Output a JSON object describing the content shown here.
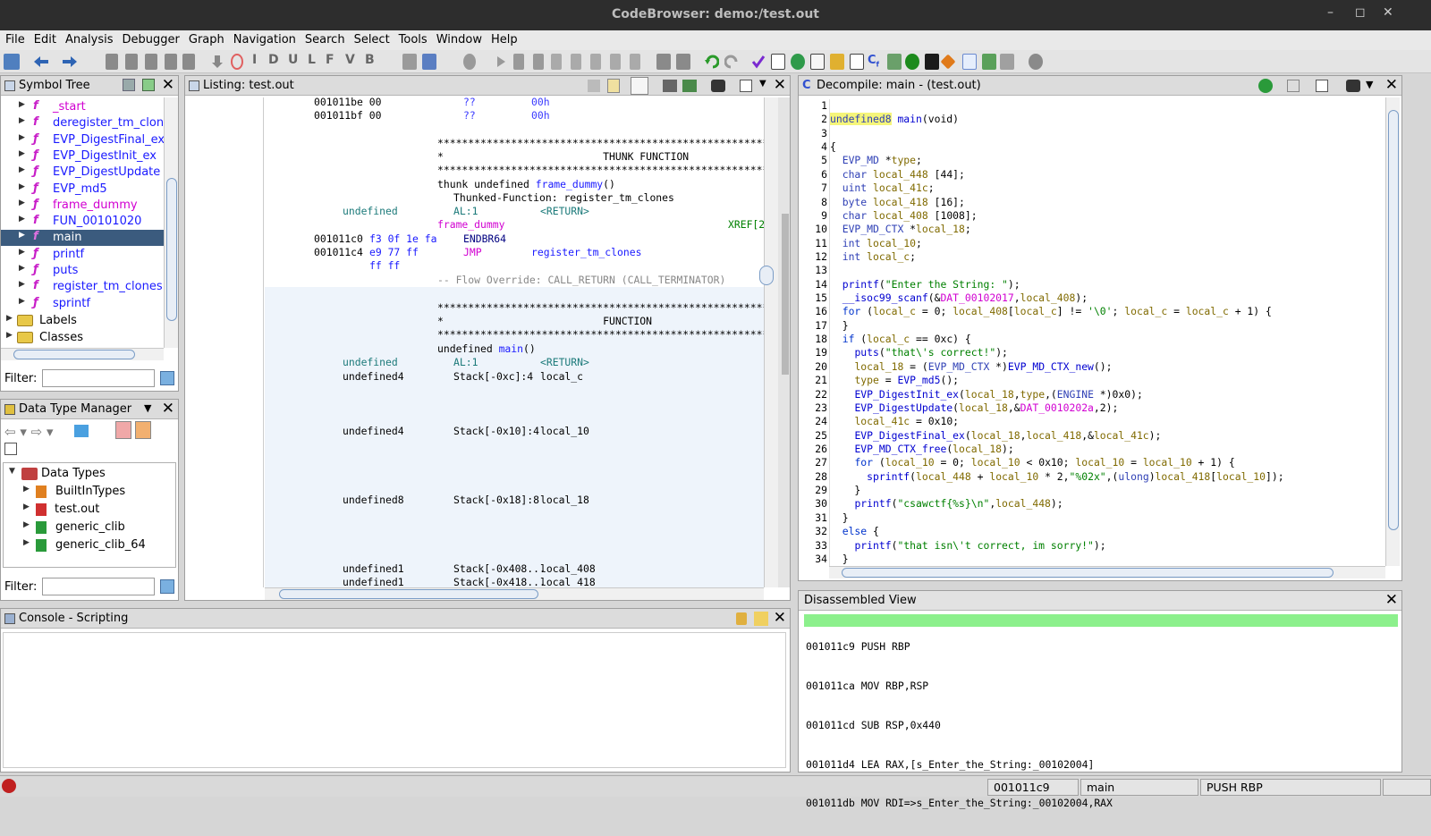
{
  "window": {
    "title": "CodeBrowser: demo:/test.out",
    "controls": [
      "–",
      "◻",
      "✕"
    ]
  },
  "menu": [
    "File",
    "Edit",
    "Analysis",
    "Debugger",
    "Graph",
    "Navigation",
    "Search",
    "Select",
    "Tools",
    "Window",
    "Help"
  ],
  "toolbar": {
    "letters": [
      "I",
      "D",
      "U",
      "L",
      "F",
      "V",
      "B"
    ]
  },
  "symbol_tree": {
    "title": "Symbol Tree",
    "items": [
      {
        "name": "_start",
        "color": "#d100d1",
        "thunk": false
      },
      {
        "name": "deregister_tm_clones",
        "color": "#1a1aff",
        "thunk": false
      },
      {
        "name": "EVP_DigestFinal_ex",
        "color": "#1a1aff",
        "thunk": true
      },
      {
        "name": "EVP_DigestInit_ex",
        "color": "#1a1aff",
        "thunk": true
      },
      {
        "name": "EVP_DigestUpdate",
        "color": "#1a1aff",
        "thunk": true
      },
      {
        "name": "EVP_md5",
        "color": "#1a1aff",
        "thunk": true
      },
      {
        "name": "frame_dummy",
        "color": "#d100d1",
        "thunk": true
      },
      {
        "name": "FUN_00101020",
        "color": "#1a1aff",
        "thunk": false
      },
      {
        "name": "main",
        "color": "#ffffff",
        "thunk": false,
        "selected": true
      },
      {
        "name": "printf",
        "color": "#1a1aff",
        "thunk": true
      },
      {
        "name": "puts",
        "color": "#1a1aff",
        "thunk": true
      },
      {
        "name": "register_tm_clones",
        "color": "#1a1aff",
        "thunk": false
      },
      {
        "name": "sprintf",
        "color": "#1a1aff",
        "thunk": true
      }
    ],
    "folders": [
      "Labels",
      "Classes"
    ],
    "filter_label": "Filter:"
  },
  "dtm": {
    "title": "Data Type Manager",
    "root": "Data Types",
    "items": [
      "BuiltInTypes",
      "test.out",
      "generic_clib",
      "generic_clib_64"
    ],
    "filter_label": "Filter:"
  },
  "listing": {
    "title": "Listing:  test.out",
    "lines": {
      "l1a": "001011be 00",
      "l1b": "??",
      "l1c": "00h",
      "l2a": "001011bf 00",
      "l2b": "??",
      "l2c": "00h",
      "stars": "**************************************************************",
      "thunk_hdr": "*                          THUNK FUNCTION",
      "thunk_sig_a": "thunk undefined ",
      "thunk_sig_b": "frame_dummy",
      "thunk_sig_c": "()",
      "thunked": "Thunked-Function: register_tm_clones",
      "undef": "undefined",
      "al1": "AL:1",
      "ret": "<RETURN>",
      "frame_dummy": "frame_dummy",
      "xref": "XREF[2",
      "c0a": "001011c0",
      "c0b": "f3 0f 1e fa",
      "c0c": "ENDBR64",
      "c4a": "001011c4",
      "c4b": "e9 77 ff",
      "c4c": "JMP",
      "c4d": "register_tm_clones",
      "c4e": "ff ff",
      "flow": "-- Flow Override: CALL_RETURN (CALL_TERMINATOR)",
      "func_hdr": "*                          FUNCTION",
      "main_sig_a": "undefined ",
      "main_sig_b": "main",
      "main_sig_c": "()",
      "u4": "undefined4",
      "u8": "undefined8",
      "u1": "undefined1",
      "s1a": "Stack[-0xc]:4",
      "s1b": "local_c",
      "s2a": "Stack[-0x10]:4",
      "s2b": "local_10",
      "s3a": "Stack[-0x18]:8",
      "s3b": "local_18",
      "s4a": "Stack[-0x408...",
      "s4b": "local_408",
      "s5a": "Stack[-0x418...",
      "s5b": "local_418"
    }
  },
  "decompile": {
    "title": "Decompile: main -  (test.out)",
    "line_numbers": [
      "1",
      "2",
      "3",
      "4",
      "5",
      "6",
      "7",
      "8",
      "9",
      "10",
      "11",
      "12",
      "13",
      "14",
      "15",
      "16",
      "17",
      "18",
      "19",
      "20",
      "21",
      "22",
      "23",
      "24",
      "25",
      "26",
      "27",
      "28",
      "29",
      "30",
      "31",
      "32",
      "33",
      "34"
    ],
    "code": [
      [],
      [
        [
          "undefined8",
          "ty"
        ],
        [
          " ",
          ""
        ],
        [
          "main",
          "fn"
        ],
        [
          "(void)",
          ""
        ]
      ],
      [],
      [
        [
          "{",
          ""
        ]
      ],
      [
        [
          "  ",
          ""
        ],
        [
          "EVP_MD",
          "ty"
        ],
        [
          " *",
          ""
        ],
        [
          "type",
          "var"
        ],
        [
          ";",
          ""
        ]
      ],
      [
        [
          "  ",
          ""
        ],
        [
          "char",
          "ty"
        ],
        [
          " ",
          ""
        ],
        [
          "local_448",
          "var"
        ],
        [
          " [44];",
          ""
        ]
      ],
      [
        [
          "  ",
          ""
        ],
        [
          "uint",
          "ty"
        ],
        [
          " ",
          ""
        ],
        [
          "local_41c",
          "var"
        ],
        [
          ";",
          ""
        ]
      ],
      [
        [
          "  ",
          ""
        ],
        [
          "byte",
          "ty"
        ],
        [
          " ",
          ""
        ],
        [
          "local_418",
          "var"
        ],
        [
          " [16];",
          ""
        ]
      ],
      [
        [
          "  ",
          ""
        ],
        [
          "char",
          "ty"
        ],
        [
          " ",
          ""
        ],
        [
          "local_408",
          "var"
        ],
        [
          " [1008];",
          ""
        ]
      ],
      [
        [
          "  ",
          ""
        ],
        [
          "EVP_MD_CTX",
          "ty"
        ],
        [
          " *",
          ""
        ],
        [
          "local_18",
          "var"
        ],
        [
          ";",
          ""
        ]
      ],
      [
        [
          "  ",
          ""
        ],
        [
          "int",
          "ty"
        ],
        [
          " ",
          ""
        ],
        [
          "local_10",
          "var"
        ],
        [
          ";",
          ""
        ]
      ],
      [
        [
          "  ",
          ""
        ],
        [
          "int",
          "ty"
        ],
        [
          " ",
          ""
        ],
        [
          "local_c",
          "var"
        ],
        [
          ";",
          ""
        ]
      ],
      [],
      [
        [
          "  ",
          ""
        ],
        [
          "printf",
          "fn"
        ],
        [
          "(",
          ""
        ],
        [
          "\"Enter the String: \"",
          "str"
        ],
        [
          ");",
          ""
        ]
      ],
      [
        [
          "  ",
          ""
        ],
        [
          "__isoc99_scanf",
          "fn"
        ],
        [
          "(&",
          ""
        ],
        [
          "DAT_00102017",
          "glb"
        ],
        [
          ",",
          ""
        ],
        [
          "local_408",
          "var"
        ],
        [
          ");",
          ""
        ]
      ],
      [
        [
          "  ",
          ""
        ],
        [
          "for",
          "kw"
        ],
        [
          " (",
          ""
        ],
        [
          "local_c",
          "var"
        ],
        [
          " = 0; ",
          ""
        ],
        [
          "local_408",
          "var"
        ],
        [
          "[",
          ""
        ],
        [
          "local_c",
          "var"
        ],
        [
          "] != ",
          ""
        ],
        [
          "'\\0'",
          "str"
        ],
        [
          "; ",
          ""
        ],
        [
          "local_c",
          "var"
        ],
        [
          " = ",
          ""
        ],
        [
          "local_c",
          "var"
        ],
        [
          " + 1) {",
          ""
        ]
      ],
      [
        [
          "  }",
          ""
        ]
      ],
      [
        [
          "  ",
          ""
        ],
        [
          "if",
          "kw"
        ],
        [
          " (",
          ""
        ],
        [
          "local_c",
          "var"
        ],
        [
          " == 0xc) {",
          ""
        ]
      ],
      [
        [
          "    ",
          ""
        ],
        [
          "puts",
          "fn"
        ],
        [
          "(",
          ""
        ],
        [
          "\"that\\'s correct!\"",
          "str"
        ],
        [
          ");",
          ""
        ]
      ],
      [
        [
          "    ",
          ""
        ],
        [
          "local_18",
          "var"
        ],
        [
          " = (",
          ""
        ],
        [
          "EVP_MD_CTX",
          "ty"
        ],
        [
          " *)",
          ""
        ],
        [
          "EVP_MD_CTX_new",
          "fn"
        ],
        [
          "();",
          ""
        ]
      ],
      [
        [
          "    ",
          ""
        ],
        [
          "type",
          "var"
        ],
        [
          " = ",
          ""
        ],
        [
          "EVP_md5",
          "fn"
        ],
        [
          "();",
          ""
        ]
      ],
      [
        [
          "    ",
          ""
        ],
        [
          "EVP_DigestInit_ex",
          "fn"
        ],
        [
          "(",
          ""
        ],
        [
          "local_18",
          "var"
        ],
        [
          ",",
          ""
        ],
        [
          "type",
          "var"
        ],
        [
          ",(",
          ""
        ],
        [
          "ENGINE",
          "ty"
        ],
        [
          " *)0x0);",
          ""
        ]
      ],
      [
        [
          "    ",
          ""
        ],
        [
          "EVP_DigestUpdate",
          "fn"
        ],
        [
          "(",
          ""
        ],
        [
          "local_18",
          "var"
        ],
        [
          ",&",
          ""
        ],
        [
          "DAT_0010202a",
          "glb"
        ],
        [
          ",2);",
          ""
        ]
      ],
      [
        [
          "    ",
          ""
        ],
        [
          "local_41c",
          "var"
        ],
        [
          " = 0x10;",
          ""
        ]
      ],
      [
        [
          "    ",
          ""
        ],
        [
          "EVP_DigestFinal_ex",
          "fn"
        ],
        [
          "(",
          ""
        ],
        [
          "local_18",
          "var"
        ],
        [
          ",",
          ""
        ],
        [
          "local_418",
          "var"
        ],
        [
          ",&",
          ""
        ],
        [
          "local_41c",
          "var"
        ],
        [
          ");",
          ""
        ]
      ],
      [
        [
          "    ",
          ""
        ],
        [
          "EVP_MD_CTX_free",
          "fn"
        ],
        [
          "(",
          ""
        ],
        [
          "local_18",
          "var"
        ],
        [
          ");",
          ""
        ]
      ],
      [
        [
          "    ",
          ""
        ],
        [
          "for",
          "kw"
        ],
        [
          " (",
          ""
        ],
        [
          "local_10",
          "var"
        ],
        [
          " = 0; ",
          ""
        ],
        [
          "local_10",
          "var"
        ],
        [
          " < 0x10; ",
          ""
        ],
        [
          "local_10",
          "var"
        ],
        [
          " = ",
          ""
        ],
        [
          "local_10",
          "var"
        ],
        [
          " + 1) {",
          ""
        ]
      ],
      [
        [
          "      ",
          ""
        ],
        [
          "sprintf",
          "fn"
        ],
        [
          "(",
          ""
        ],
        [
          "local_448",
          "var"
        ],
        [
          " + ",
          ""
        ],
        [
          "local_10",
          "var"
        ],
        [
          " * 2,",
          ""
        ],
        [
          "\"%02x\"",
          "str"
        ],
        [
          ",(",
          ""
        ],
        [
          "ulong",
          "ty"
        ],
        [
          ")",
          ""
        ],
        [
          "local_418",
          "var"
        ],
        [
          "[",
          ""
        ],
        [
          "local_10",
          "var"
        ],
        [
          "]);",
          ""
        ]
      ],
      [
        [
          "    }",
          ""
        ]
      ],
      [
        [
          "    ",
          ""
        ],
        [
          "printf",
          "fn"
        ],
        [
          "(",
          ""
        ],
        [
          "\"csawctf{%s}\\n\"",
          "str"
        ],
        [
          ",",
          ""
        ],
        [
          "local_448",
          "var"
        ],
        [
          ");",
          ""
        ]
      ],
      [
        [
          "  }",
          ""
        ]
      ],
      [
        [
          "  ",
          ""
        ],
        [
          "else",
          "kw"
        ],
        [
          " {",
          ""
        ]
      ],
      [
        [
          "    ",
          ""
        ],
        [
          "printf",
          "fn"
        ],
        [
          "(",
          ""
        ],
        [
          "\"that isn\\'t correct, im sorry!\"",
          "str"
        ],
        [
          ");",
          ""
        ]
      ],
      [
        [
          "  }",
          ""
        ]
      ]
    ]
  },
  "disassembled": {
    "title": "Disassembled View",
    "lines": [
      "001011c9 PUSH RBP",
      "001011ca MOV RBP,RSP",
      "001011cd SUB RSP,0x440",
      "001011d4 LEA RAX,[s_Enter_the_String:_00102004]",
      "001011db MOV RDI=>s_Enter_the_String:_00102004,RAX"
    ]
  },
  "console": {
    "title": "Console - Scripting"
  },
  "status": {
    "address": "001011c9",
    "function": "main",
    "instruction": "PUSH RBP"
  }
}
